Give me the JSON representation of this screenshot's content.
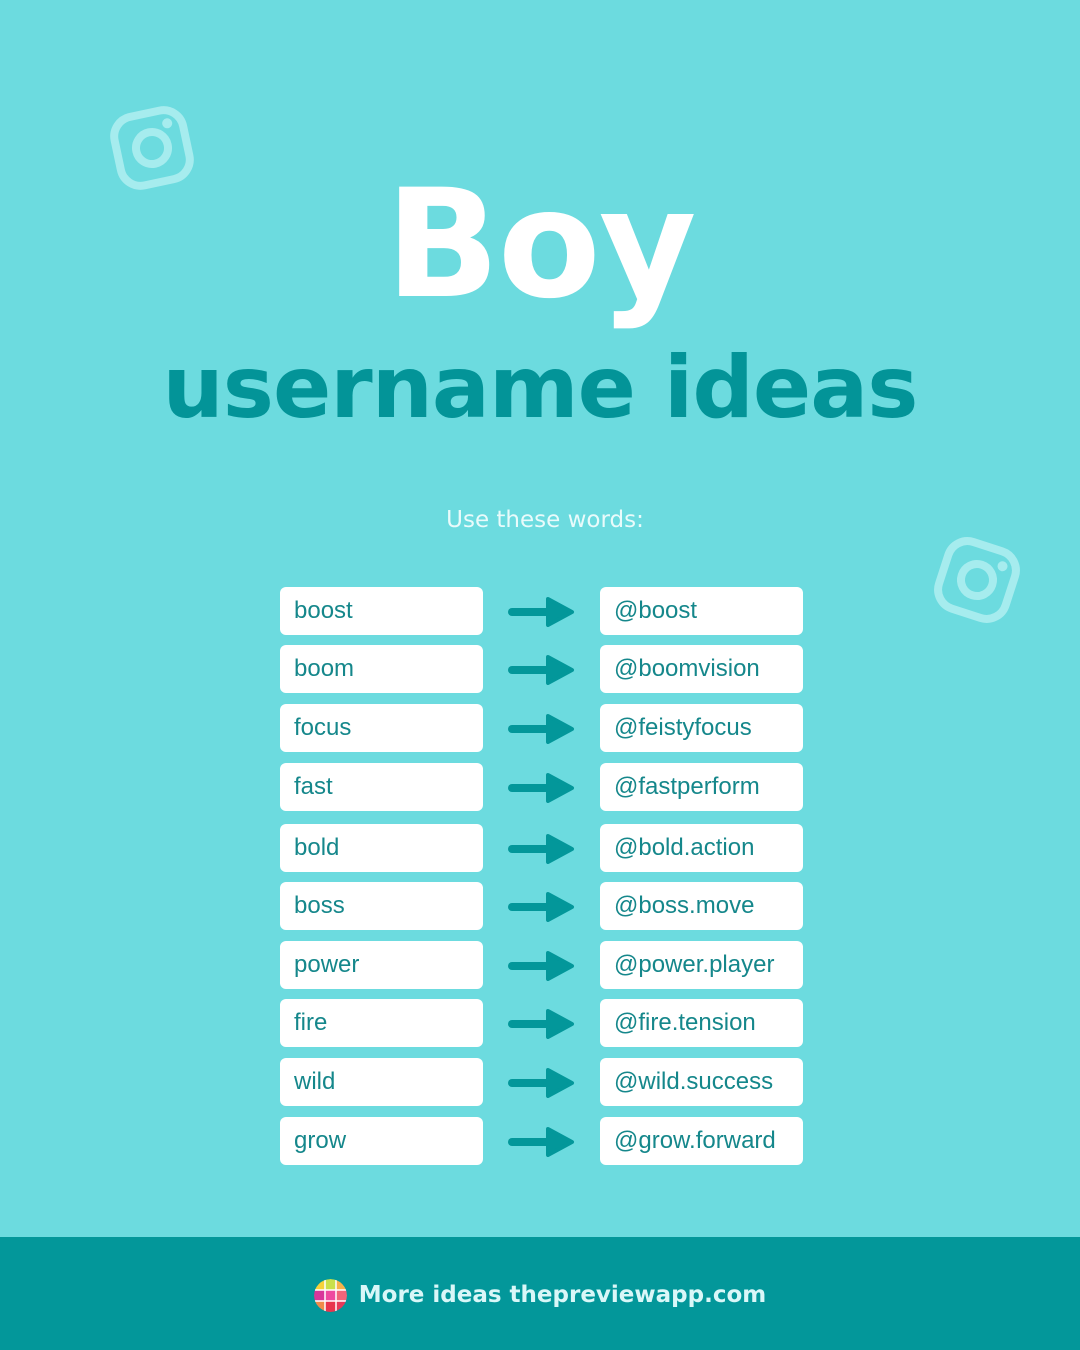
{
  "colors": {
    "background": "#6cdbdf",
    "title": "#ffffff",
    "subtitle": "#039498",
    "text": "#15878b",
    "arrow": "#03979a",
    "footer": "#03979a"
  },
  "header": {
    "title": "Boy",
    "subtitle": "username ideas",
    "intro": "Use these words:"
  },
  "icons": [
    "instagram-icon",
    "instagram-icon",
    "arrow-right-icon",
    "app-logo-icon"
  ],
  "rows": [
    {
      "word": "boost",
      "username": "@boost"
    },
    {
      "word": "boom",
      "username": "@boomvision"
    },
    {
      "word": "focus",
      "username": "@feistyfocus"
    },
    {
      "word": "fast",
      "username": "@fastperform"
    },
    {
      "word": "bold",
      "username": "@bold.action"
    },
    {
      "word": "boss",
      "username": "@boss.move"
    },
    {
      "word": "power",
      "username": "@power.player"
    },
    {
      "word": "fire",
      "username": "@fire.tension"
    },
    {
      "word": "wild",
      "username": "@wild.success"
    },
    {
      "word": "grow",
      "username": "@grow.forward"
    }
  ],
  "footer": {
    "text": "More ideas thepreviewapp.com"
  }
}
